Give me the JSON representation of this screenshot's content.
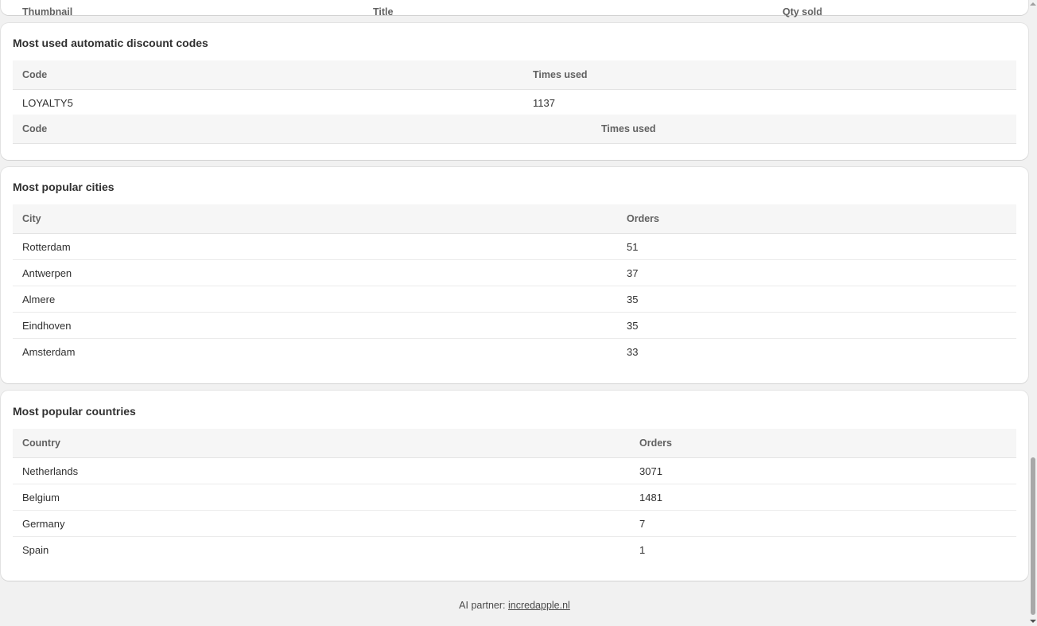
{
  "partial_card": {
    "columns": [
      "Thumbnail",
      "Title",
      "Qty sold"
    ]
  },
  "discount_codes": {
    "title": "Most used automatic discount codes",
    "headers": [
      "Code",
      "Times used"
    ],
    "rows": [
      [
        "LOYALTY5",
        "1137"
      ]
    ],
    "second_headers": [
      "Code",
      "Times used"
    ]
  },
  "cities": {
    "title": "Most popular cities",
    "headers": [
      "City",
      "Orders"
    ],
    "rows": [
      [
        "Rotterdam",
        "51"
      ],
      [
        "Antwerpen",
        "37"
      ],
      [
        "Almere",
        "35"
      ],
      [
        "Eindhoven",
        "35"
      ],
      [
        "Amsterdam",
        "33"
      ]
    ]
  },
  "countries": {
    "title": "Most popular countries",
    "headers": [
      "Country",
      "Orders"
    ],
    "rows": [
      [
        "Netherlands",
        "3071"
      ],
      [
        "Belgium",
        "1481"
      ],
      [
        "Germany",
        "7"
      ],
      [
        "Spain",
        "1"
      ]
    ]
  },
  "footer": {
    "prefix": "AI partner: ",
    "link_text": "incredapple.nl"
  }
}
